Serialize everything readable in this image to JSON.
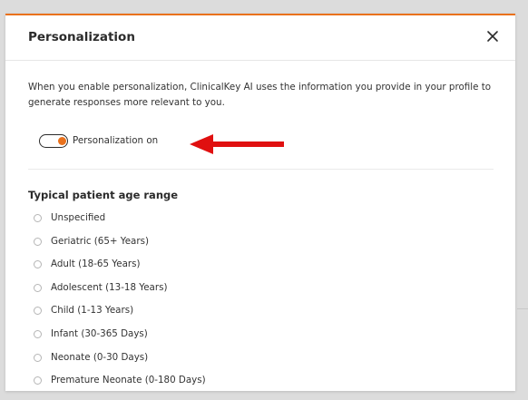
{
  "dialog": {
    "title": "Personalization",
    "description": "When you enable personalization, ClinicalKey AI uses the information you provide in your profile to generate responses more relevant to you.",
    "toggle": {
      "label": "Personalization on",
      "state": "on"
    },
    "close_icon": "close-icon"
  },
  "age_range": {
    "title": "Typical patient age range",
    "options": [
      "Unspecified",
      "Geriatric (65+ Years)",
      "Adult (18-65 Years)",
      "Adolescent (13-18 Years)",
      "Child (1-13 Years)",
      "Infant (30-365 Days)",
      "Neonate (0-30 Days)",
      "Premature Neonate (0-180 Days)"
    ]
  },
  "annotation": {
    "icon": "red-arrow-icon"
  },
  "colors": {
    "accent": "#e9711c",
    "arrow": "#e01010",
    "backdrop": "#dcdcdc"
  }
}
